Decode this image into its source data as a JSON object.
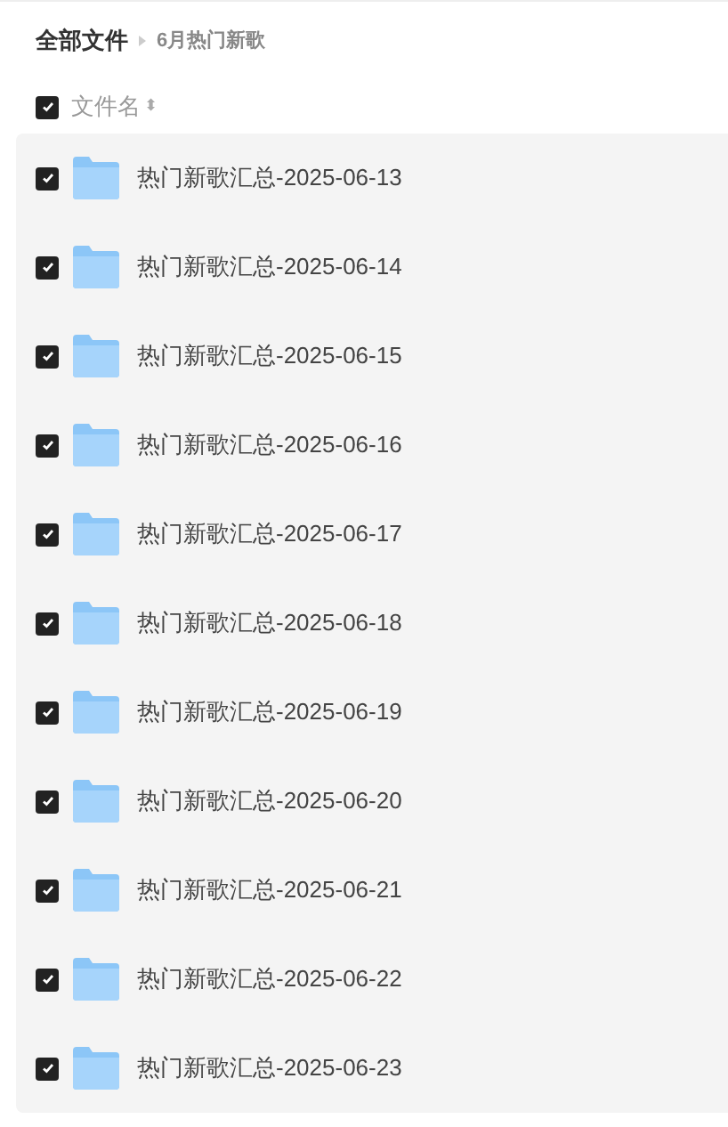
{
  "breadcrumb": [
    {
      "label": "全部文件"
    },
    {
      "label": "6月热门新歌"
    }
  ],
  "header": {
    "checked": true,
    "column": "文件名",
    "sort_icon": "⬍"
  },
  "rows": [
    {
      "name": "热门新歌汇总-2025-06-13",
      "checked": true
    },
    {
      "name": "热门新歌汇总-2025-06-14",
      "checked": true
    },
    {
      "name": "热门新歌汇总-2025-06-15",
      "checked": true
    },
    {
      "name": "热门新歌汇总-2025-06-16",
      "checked": true
    },
    {
      "name": "热门新歌汇总-2025-06-17",
      "checked": true
    },
    {
      "name": "热门新歌汇总-2025-06-18",
      "checked": true
    },
    {
      "name": "热门新歌汇总-2025-06-19",
      "checked": true
    },
    {
      "name": "热门新歌汇总-2025-06-20",
      "checked": true
    },
    {
      "name": "热门新歌汇总-2025-06-21",
      "checked": true
    },
    {
      "name": "热门新歌汇总-2025-06-22",
      "checked": true
    },
    {
      "name": "热门新歌汇总-2025-06-23",
      "checked": true
    }
  ]
}
